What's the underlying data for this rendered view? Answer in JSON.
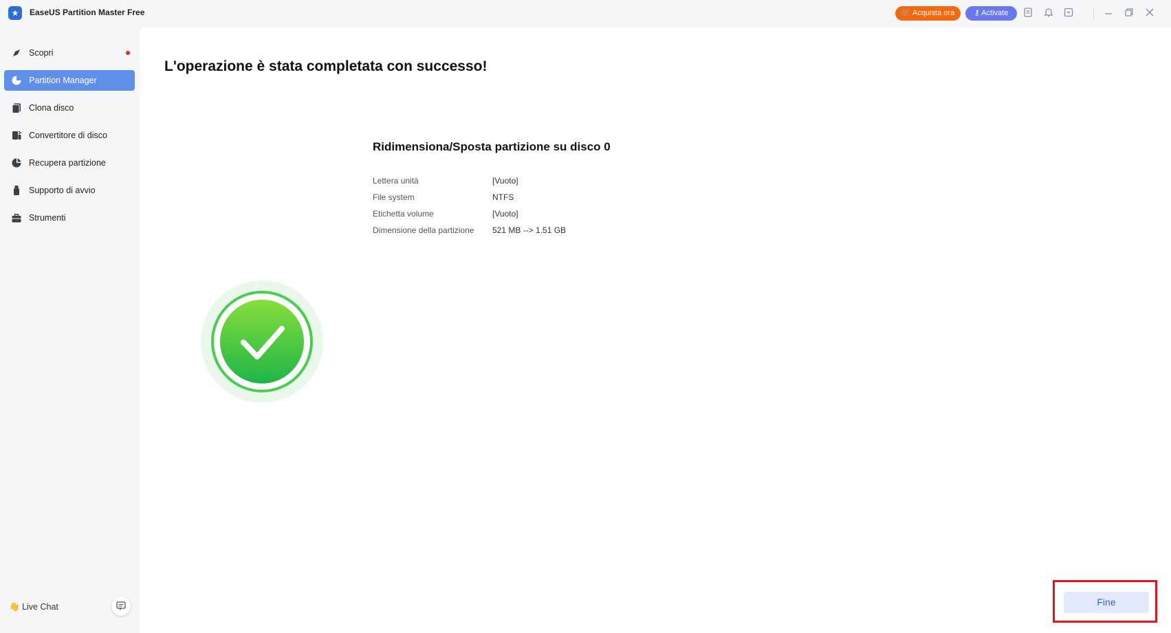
{
  "window": {
    "title": "EaseUS Partition Master Free",
    "buy_label": "Acquista ora",
    "activate_label": "Activate"
  },
  "sidebar": {
    "items": [
      {
        "label": "Scopri",
        "icon": "compass-icon",
        "badge": true
      },
      {
        "label": "Partition Manager",
        "icon": "pie-chart-icon",
        "active": true
      },
      {
        "label": "Clona disco",
        "icon": "clone-disk-icon"
      },
      {
        "label": "Convertitore di disco",
        "icon": "disk-convert-icon"
      },
      {
        "label": "Recupera partizione",
        "icon": "recover-partition-icon"
      },
      {
        "label": "Supporto di avvio",
        "icon": "usb-drive-icon"
      },
      {
        "label": "Strumenti",
        "icon": "toolbox-icon"
      }
    ],
    "live_chat_label": "Live Chat"
  },
  "main": {
    "headline": "L'operazione è stata completata con successo!",
    "operation_title": "Ridimensiona/Sposta partizione su disco 0",
    "properties": [
      {
        "label": "Lettera unità",
        "value": "[Vuoto]"
      },
      {
        "label": "File system",
        "value": "NTFS"
      },
      {
        "label": "Etichetta volume",
        "value": "[Vuoto]"
      },
      {
        "label": "Dimensione della partizione",
        "value": "521 MB --> 1.51 GB"
      }
    ],
    "finish_label": "Fine"
  },
  "colors": {
    "accent": "#5f8fe8",
    "buy": "#f4680f",
    "activate": "#6a78ee",
    "success": "#2fbf3d",
    "highlight": "#e8121b"
  }
}
